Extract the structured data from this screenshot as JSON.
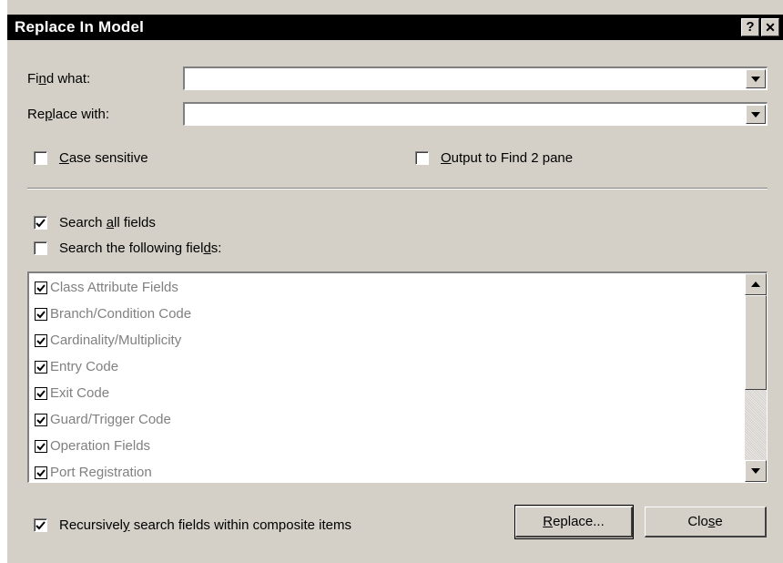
{
  "dialog": {
    "title": "Replace In Model",
    "help_label": "?",
    "close_label": "✕"
  },
  "find": {
    "label_pre": "Fi",
    "label_acc": "n",
    "label_post": "d what:",
    "value": "",
    "dropdown_icon": "triangle-down-icon"
  },
  "replace": {
    "label_pre": "Re",
    "label_acc": "p",
    "label_post": "lace with:",
    "value": "",
    "dropdown_icon": "triangle-down-icon"
  },
  "options": {
    "case_sensitive": {
      "acc": "C",
      "rest": "ase sensitive",
      "checked": false
    },
    "output_find2": {
      "acc": "O",
      "rest": "utput to Find 2 pane",
      "checked": false
    }
  },
  "scope": {
    "search_all": {
      "pre": "Search ",
      "acc": "a",
      "post": "ll fields",
      "checked": true
    },
    "search_following": {
      "pre": "Search the following fiel",
      "acc": "d",
      "post": "s:",
      "checked": false
    }
  },
  "fields": [
    {
      "label": "Class Attribute Fields",
      "checked": true
    },
    {
      "label": "Branch/Condition Code",
      "checked": true
    },
    {
      "label": "Cardinality/Multiplicity",
      "checked": true
    },
    {
      "label": "Entry Code",
      "checked": true
    },
    {
      "label": "Exit Code",
      "checked": true
    },
    {
      "label": "Guard/Trigger Code",
      "checked": true
    },
    {
      "label": "Operation Fields",
      "checked": true
    },
    {
      "label": "Port Registration",
      "checked": true
    }
  ],
  "recursive": {
    "pre": "Recursivel",
    "acc": "y",
    "post": " search fields within composite items",
    "checked": true
  },
  "buttons": {
    "replace": {
      "acc": "R",
      "rest": "eplace..."
    },
    "close": {
      "pre": "Clo",
      "acc": "s",
      "post": "e"
    }
  },
  "colors": {
    "face": "#d4d0c8",
    "titlebar": "#000000",
    "disabled_text": "#808080"
  }
}
